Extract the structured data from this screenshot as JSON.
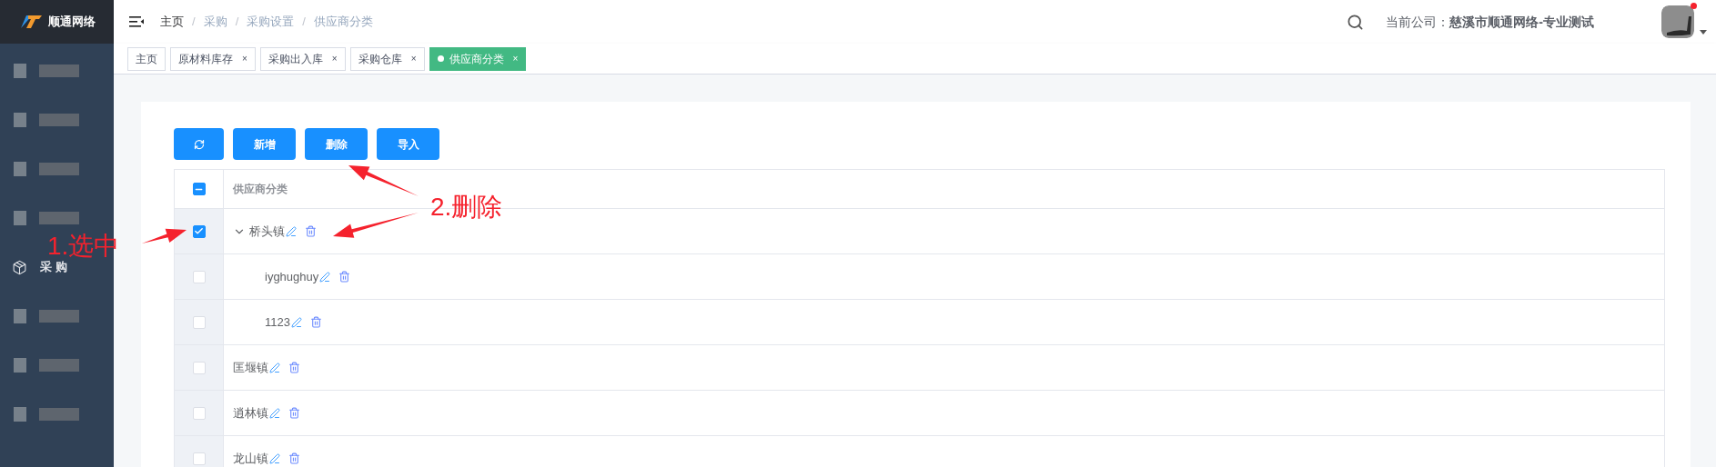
{
  "sidebar": {
    "logo": "顺通网络",
    "items": [
      {
        "kind": "redacted"
      },
      {
        "kind": "redacted"
      },
      {
        "kind": "redacted"
      },
      {
        "kind": "redacted"
      },
      {
        "kind": "menu",
        "label": "采 购"
      },
      {
        "kind": "redacted"
      },
      {
        "kind": "redacted"
      },
      {
        "kind": "redacted"
      }
    ]
  },
  "header": {
    "breadcrumb": [
      "主页",
      "采购",
      "采购设置",
      "供应商分类"
    ],
    "separator": "/",
    "company_label": "当前公司：",
    "company": "慈溪市顺通网络-专业测试",
    "notification": true
  },
  "tabs": [
    {
      "label": "主页",
      "selected": false
    },
    {
      "label": "原材料库存",
      "selected": false,
      "close": "×"
    },
    {
      "label": "采购出入库",
      "selected": false,
      "close": "×"
    },
    {
      "label": "采购仓库",
      "selected": false,
      "close": "×"
    },
    {
      "label": "供应商分类",
      "selected": true,
      "close": "×"
    }
  ],
  "toolbar": [
    {
      "kind": "refresh"
    },
    {
      "kind": "text",
      "label": "新增"
    },
    {
      "kind": "text",
      "label": "删除"
    },
    {
      "kind": "text",
      "label": "导入"
    }
  ],
  "table": {
    "header_indeterminate": true,
    "column": "供应商分类",
    "rows": [
      {
        "name": "桥头镇",
        "checked": true,
        "expanded": true,
        "children": [
          {
            "name": "iyghughuy",
            "checked": false
          },
          {
            "name": "1123",
            "checked": false
          }
        ]
      },
      {
        "name": "匡堰镇",
        "checked": false
      },
      {
        "name": "逍林镇",
        "checked": false
      },
      {
        "name": "龙山镇",
        "checked": false
      }
    ]
  },
  "annotations": [
    {
      "text": "1.选中"
    },
    {
      "text": "2.删除"
    }
  ]
}
